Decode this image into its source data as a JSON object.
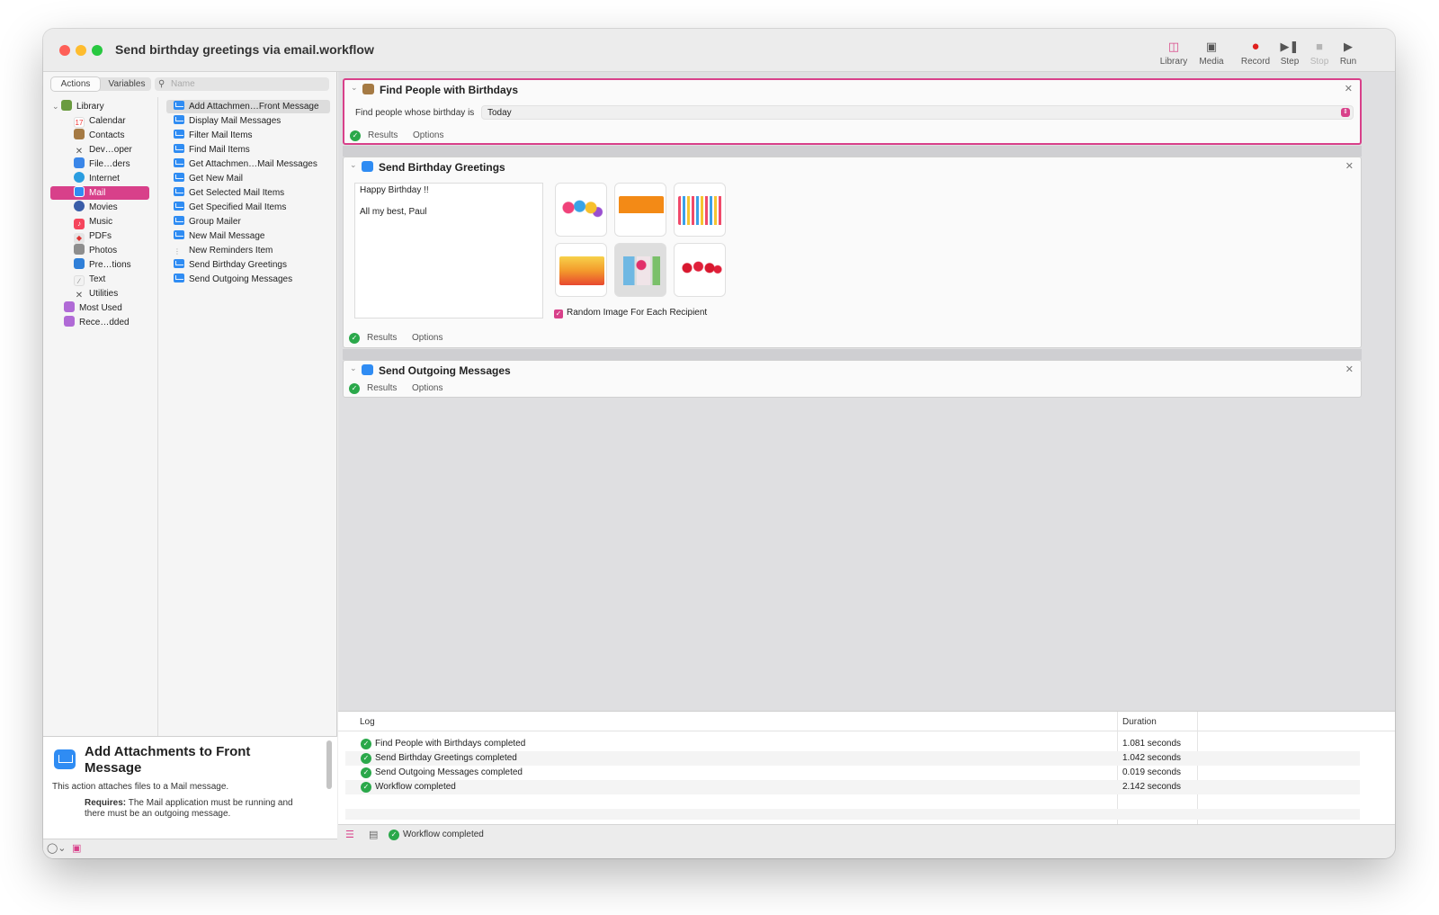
{
  "window": {
    "title": "Send birthday greetings via email.workflow"
  },
  "toolbar": {
    "library": "Library",
    "media": "Media",
    "record": "Record",
    "step": "Step",
    "stop": "Stop",
    "run": "Run"
  },
  "library_pane": {
    "tabs": [
      "Actions",
      "Variables"
    ],
    "search_placeholder": "Name",
    "categories": [
      {
        "label": "Library",
        "color": "#6a9b3f",
        "icon": "library-icon"
      },
      {
        "label": "Calendar",
        "color": "#ffffff",
        "icon": "calendar-icon"
      },
      {
        "label": "Contacts",
        "color": "#a57a44",
        "icon": "contacts-icon"
      },
      {
        "label": "Dev…oper",
        "color": "#5a5a5a",
        "icon": "developer-icon"
      },
      {
        "label": "File…ders",
        "color": "#3a86e8",
        "icon": "finder-icon"
      },
      {
        "label": "Internet",
        "color": "#2a9de0",
        "icon": "globe-icon"
      },
      {
        "label": "Mail",
        "color": "#2f8cf3",
        "icon": "mail-icon"
      },
      {
        "label": "Movies",
        "color": "#3a5da8",
        "icon": "movies-icon"
      },
      {
        "label": "Music",
        "color": "#f5455c",
        "icon": "music-icon"
      },
      {
        "label": "PDFs",
        "color": "#e5e5e5",
        "icon": "pdf-icon"
      },
      {
        "label": "Photos",
        "color": "#8e8e8e",
        "icon": "photos-icon"
      },
      {
        "label": "Pre…tions",
        "color": "#2f7fd8",
        "icon": "presentations-icon"
      },
      {
        "label": "Text",
        "color": "#e8e8e8",
        "icon": "text-icon"
      },
      {
        "label": "Utilities",
        "color": "#5a5a5a",
        "icon": "utilities-icon"
      },
      {
        "label": "Most Used",
        "color": "#b06ad6",
        "icon": "smart-folder-icon"
      },
      {
        "label": "Rece…dded",
        "color": "#b06ad6",
        "icon": "smart-folder-icon"
      }
    ],
    "selected_category": "Mail",
    "actions": [
      "Add Attachmen…Front Message",
      "Display Mail Messages",
      "Filter Mail Items",
      "Find Mail Items",
      "Get Attachmen…Mail Messages",
      "Get New Mail",
      "Get Selected Mail Items",
      "Get Specified Mail Items",
      "Group Mailer",
      "New Mail Message",
      "New Reminders Item",
      "Send Birthday Greetings",
      "Send Outgoing Messages"
    ],
    "selected_action": "Add Attachmen…Front Message",
    "description": {
      "title": "Add Attachments to Front Message",
      "text": "This action attaches files to a Mail message.",
      "requires_label": "Requires:",
      "requires_text": "The Mail application must be running and there must be an outgoing message."
    }
  },
  "workflow": {
    "actions": [
      {
        "title": "Find People with Birthdays",
        "field_label": "Find people whose birthday is",
        "field_value": "Today",
        "results": "Results",
        "options": "Options"
      },
      {
        "title": "Send Birthday Greetings",
        "message_line1": "Happy Birthday !!",
        "message_line2": "All my best, Paul",
        "checkbox_label": "Random Image For Each Recipient",
        "results": "Results",
        "options": "Options"
      },
      {
        "title": "Send Outgoing Messages",
        "results": "Results",
        "options": "Options"
      }
    ]
  },
  "log": {
    "col_log": "Log",
    "col_duration": "Duration",
    "rows": [
      {
        "message": "Find People with Birthdays completed",
        "duration": "1.081 seconds"
      },
      {
        "message": "Send Birthday Greetings completed",
        "duration": "1.042 seconds"
      },
      {
        "message": "Send Outgoing Messages completed",
        "duration": "0.019 seconds"
      },
      {
        "message": "Workflow completed",
        "duration": "2.142 seconds"
      }
    ]
  },
  "status": {
    "text": "Workflow completed"
  },
  "colors": {
    "accent": "#d8408a",
    "success": "#2aa84a",
    "mail": "#2f8cf3"
  }
}
